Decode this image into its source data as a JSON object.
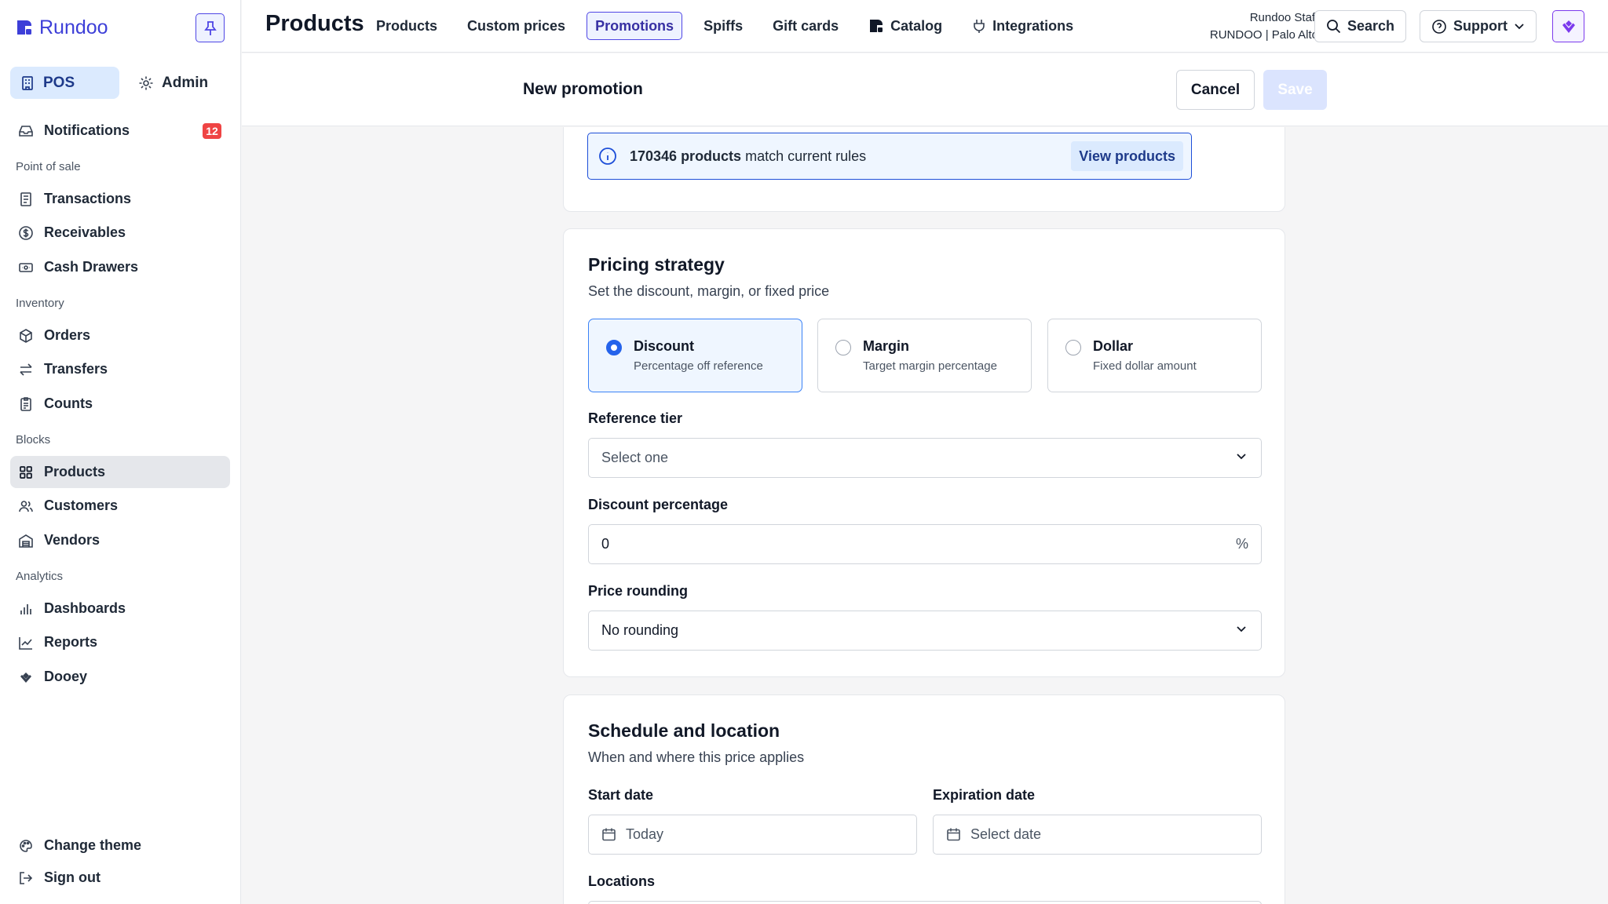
{
  "app": {
    "name": "Rundoo"
  },
  "sidebar": {
    "modes": [
      {
        "label": "POS"
      },
      {
        "label": "Admin"
      }
    ],
    "notifications": {
      "label": "Notifications",
      "count": "12"
    },
    "sections": {
      "point_of_sale": "Point of sale",
      "inventory": "Inventory",
      "blocks": "Blocks",
      "analytics": "Analytics"
    },
    "items": {
      "transactions": "Transactions",
      "receivables": "Receivables",
      "cash_drawers": "Cash Drawers",
      "orders": "Orders",
      "transfers": "Transfers",
      "counts": "Counts",
      "products": "Products",
      "customers": "Customers",
      "vendors": "Vendors",
      "dashboards": "Dashboards",
      "reports": "Reports",
      "dooey": "Dooey"
    },
    "footer": {
      "change_theme": "Change theme",
      "sign_out": "Sign out"
    }
  },
  "header": {
    "title": "Products",
    "tabs": [
      {
        "label": "Products"
      },
      {
        "label": "Custom prices"
      },
      {
        "label": "Promotions"
      },
      {
        "label": "Spiffs"
      },
      {
        "label": "Gift cards"
      },
      {
        "label": "Catalog"
      },
      {
        "label": "Integrations"
      }
    ],
    "user": {
      "name": "Rundoo Staff",
      "org": "RUNDOO | Palo Alto"
    },
    "search_label": "Search",
    "support_label": "Support"
  },
  "form": {
    "title": "New promotion",
    "cancel_label": "Cancel",
    "save_label": "Save"
  },
  "match_info": {
    "count_text": "170346 products",
    "suffix": "match current rules",
    "action": "View products"
  },
  "pricing": {
    "title": "Pricing strategy",
    "subtitle": "Set the discount, margin, or fixed price",
    "options": [
      {
        "title": "Discount",
        "desc": "Percentage off reference",
        "selected": true
      },
      {
        "title": "Margin",
        "desc": "Target margin percentage",
        "selected": false
      },
      {
        "title": "Dollar",
        "desc": "Fixed dollar amount",
        "selected": false
      }
    ],
    "reference_tier": {
      "label": "Reference tier",
      "placeholder": "Select one"
    },
    "discount": {
      "label": "Discount percentage",
      "value": "0",
      "suffix": "%"
    },
    "rounding": {
      "label": "Price rounding",
      "value": "No rounding"
    }
  },
  "schedule": {
    "title": "Schedule and location",
    "subtitle": "When and where this price applies",
    "start": {
      "label": "Start date",
      "placeholder": "Today"
    },
    "expiration": {
      "label": "Expiration date",
      "placeholder": "Select date"
    },
    "locations_label": "Locations"
  },
  "colors": {
    "brand": "#3d3fd8",
    "accent": "#2563eb",
    "badge": "#ef4444"
  }
}
